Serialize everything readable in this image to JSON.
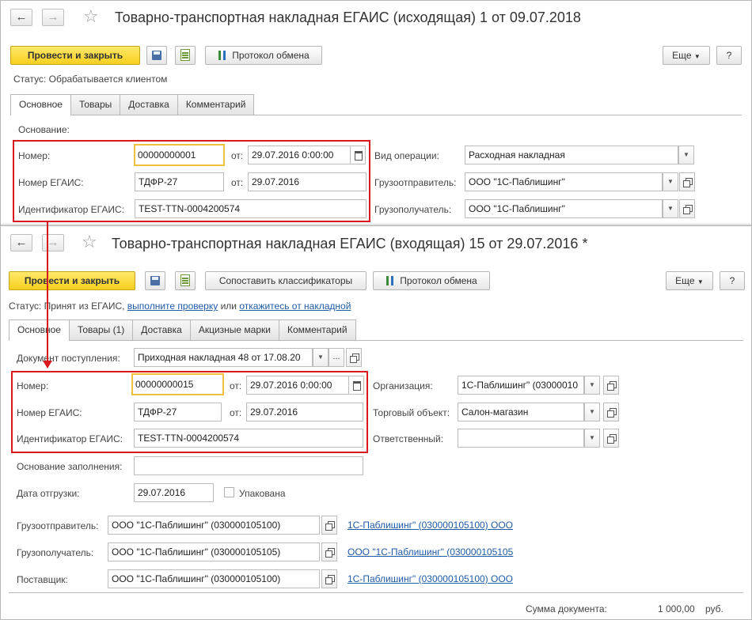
{
  "window1": {
    "title": "Товарно-транспортная накладная ЕГАИС (исходящая) 1 от 09.07.2018",
    "toolbar": {
      "post_close": "Провести и закрыть",
      "exchange_log": "Протокол обмена",
      "more": "Еще",
      "help": "?"
    },
    "status_label": "Статус:",
    "status_value": "Обрабатывается клиентом",
    "tabs": [
      "Основное",
      "Товары",
      "Доставка",
      "Комментарий"
    ],
    "osnovanie_label": "Основание:",
    "number_label": "Номер:",
    "number_value": "00000000001",
    "from_label": "от:",
    "date_value": "29.07.2016  0:00:00",
    "egais_number_label": "Номер ЕГАИС:",
    "egais_number_value": "ТДФР-27",
    "egais_date_value": "29.07.2016",
    "egais_id_label": "Идентификатор ЕГАИС:",
    "egais_id_value": "TEST-TTN-0004200574",
    "operation_label": "Вид операции:",
    "operation_value": "Расходная накладная",
    "shipper_label": "Грузоотправитель:",
    "shipper_value": "ООО \"1С-Паблишинг\"",
    "consignee_label": "Грузополучатель:",
    "consignee_value": "ООО \"1С-Паблишинг\""
  },
  "window2": {
    "title": "Товарно-транспортная накладная ЕГАИС (входящая) 15 от 29.07.2016 *",
    "toolbar": {
      "post_close": "Провести и закрыть",
      "match": "Сопоставить классификаторы",
      "exchange_log": "Протокол обмена",
      "more": "Еще",
      "help": "?"
    },
    "status_label": "Статус:",
    "status_text": "Принят из ЕГАИС,",
    "status_link1": "выполните проверку",
    "status_or": "или",
    "status_link2": "откажитесь от накладной",
    "tabs": [
      "Основное",
      "Товары (1)",
      "Доставка",
      "Акцизные марки",
      "Комментарий"
    ],
    "receipt_doc_label": "Документ поступления:",
    "receipt_doc_value": "Приходная накладная 48 от 17.08.20",
    "number_label": "Номер:",
    "number_value": "00000000015",
    "from_label": "от:",
    "date_value": "29.07.2016  0:00:00",
    "egais_number_label": "Номер ЕГАИС:",
    "egais_number_value": "ТДФР-27",
    "egais_date_value": "29.07.2016",
    "egais_id_label": "Идентификатор ЕГАИС:",
    "egais_id_value": "TEST-TTN-0004200574",
    "org_label": "Организация:",
    "org_value": "1С-Паблишинг\" (03000010",
    "trade_object_label": "Торговый объект:",
    "trade_object_value": "Салон-магазин",
    "responsible_label": "Ответственный:",
    "responsible_value": "",
    "fill_basis_label": "Основание заполнения:",
    "ship_date_label": "Дата отгрузки:",
    "ship_date_value": "29.07.2016",
    "packed_label": "Упакована",
    "shipper_label": "Грузоотправитель:",
    "shipper_value": "ООО \"1С-Паблишинг\" (030000105100)",
    "shipper_link": "1С-Паблишинг\" (030000105100) ООО",
    "consignee_label": "Грузополучатель:",
    "consignee_value": "ООО \"1С-Паблишинг\" (030000105105)",
    "consignee_link": "ООО \"1С-Паблишинг\" (030000105105",
    "supplier_label": "Поставщик:",
    "supplier_value": "ООО \"1С-Паблишинг\" (030000105100)",
    "supplier_link": "1С-Паблишинг\" (030000105100) ООО",
    "total_label": "Сумма документа:",
    "total_value": "1 000,00",
    "currency": "руб."
  },
  "colors": {
    "highlight": "#d8191e",
    "primary_button": "#f7cf1e",
    "link": "#1f5aa6",
    "focus": "#f0c040"
  },
  "icons": {
    "back": "←",
    "forward": "→",
    "star": "☆",
    "dropdown": "▼",
    "dots": "..."
  }
}
